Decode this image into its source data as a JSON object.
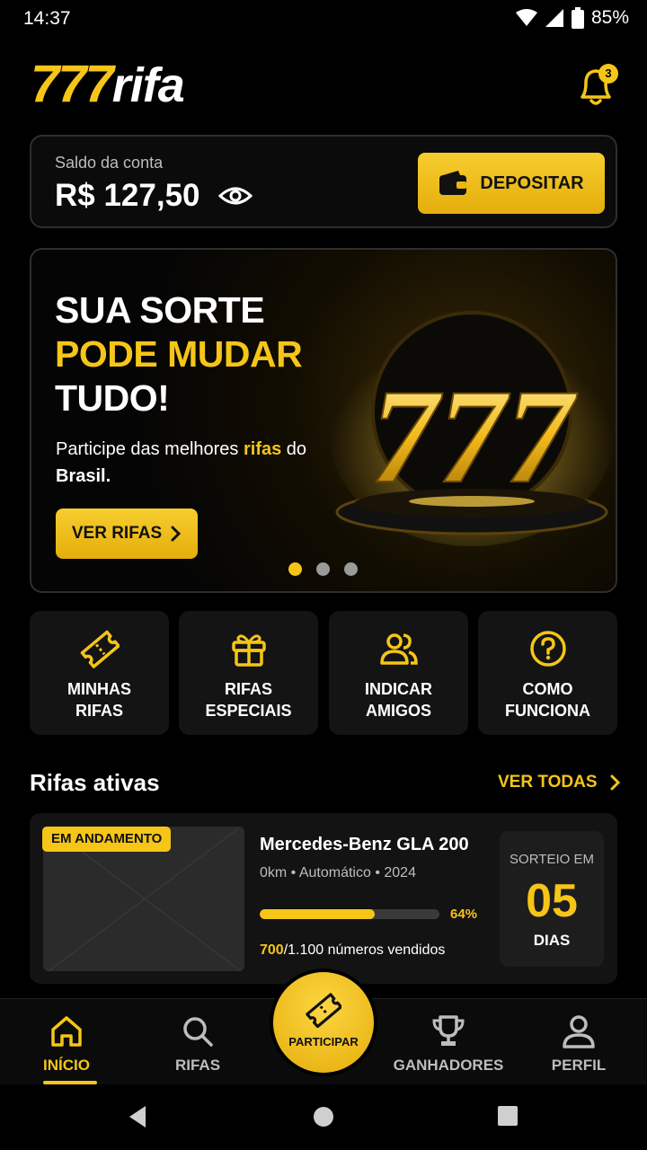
{
  "status_bar": {
    "time": "14:37",
    "battery": "85%"
  },
  "header": {
    "logo_number": "777",
    "logo_word": "rifa",
    "notification_count": "3"
  },
  "balance": {
    "label": "Saldo da conta",
    "value": "R$ 127,50",
    "deposit_label": "DEPOSITAR"
  },
  "banner": {
    "line1": "SUA SORTE",
    "line2": "PODE MUDAR",
    "line3": "TUDO!",
    "sub_part1": "Participe das melhores ",
    "sub_highlight": "rifas",
    "sub_part2": " do ",
    "sub_strong": "Brasil.",
    "cta_label": "VER RIFAS",
    "slides": 3,
    "active_slide": 1
  },
  "shortcuts": [
    {
      "label": "MINHAS\nRIFAS",
      "icon": "ticket-icon"
    },
    {
      "label": "RIFAS\nESPECIAIS",
      "icon": "gift-icon"
    },
    {
      "label": "INDICAR\nAMIGOS",
      "icon": "users-icon"
    },
    {
      "label": "COMO\nFUNCIONA",
      "icon": "question-icon"
    }
  ],
  "active_raffles": {
    "title": "Rifas ativas",
    "see_all": "VER TODAS",
    "items": [
      {
        "badge": "EM ANDAMENTO",
        "name": "Mercedes-Benz GLA 200",
        "meta": "0km • Automático • 2024",
        "progress_pct": 64,
        "progress_label": "64%",
        "sold": "700",
        "sold_rest": "/1.100 números vendidos",
        "draw_label": "SORTEIO EM",
        "draw_value": "05",
        "draw_unit": "DIAS"
      }
    ]
  },
  "bottom_nav": {
    "items": [
      {
        "label": "INÍCIO",
        "icon": "home-icon",
        "active": true
      },
      {
        "label": "RIFAS",
        "icon": "search-icon",
        "active": false
      },
      {
        "label": "GANHADORES",
        "icon": "trophy-icon",
        "active": false
      },
      {
        "label": "PERFIL",
        "icon": "user-icon",
        "active": false
      }
    ],
    "fab_label": "PARTICIPAR"
  },
  "colors": {
    "accent": "#f5c518",
    "background": "#000000",
    "card": "#141414"
  }
}
